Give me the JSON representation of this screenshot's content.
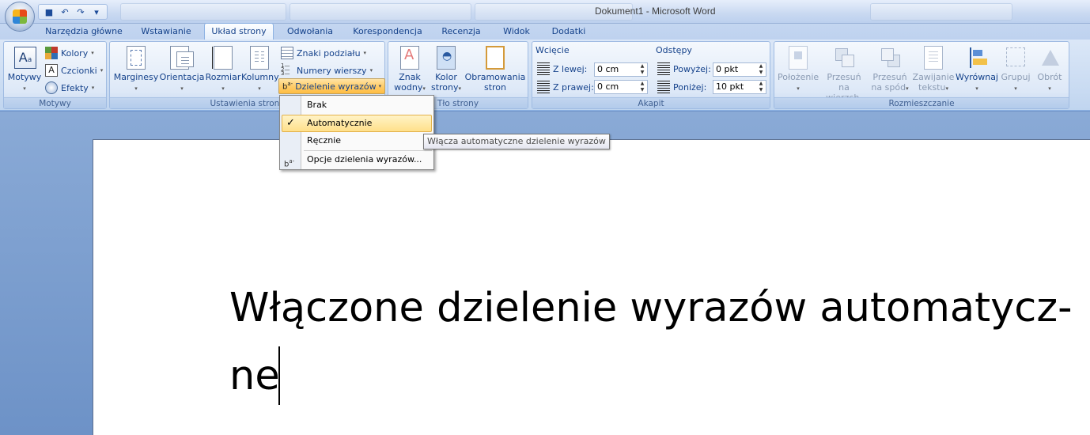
{
  "window": {
    "title": "Dokument1 - Microsoft Word"
  },
  "tabs": [
    "Narzędzia główne",
    "Wstawianie",
    "Układ strony",
    "Odwołania",
    "Korespondencja",
    "Recenzja",
    "Widok",
    "Dodatki"
  ],
  "active_tab": "Układ strony",
  "ribbon": {
    "motywy": {
      "label": "Motywy",
      "motywy_btn": "Motywy",
      "kolory": "Kolory",
      "czcionki": "Czcionki",
      "efekty": "Efekty"
    },
    "ustawienia": {
      "label": "Ustawienia strony",
      "marginesy": "Marginesy",
      "orientacja": "Orientacja",
      "rozmiar": "Rozmiar",
      "kolumny": "Kolumny",
      "znaki": "Znaki podziału",
      "numery": "Numery wierszy",
      "dzielenie": "Dzielenie wyrazów"
    },
    "tlo": {
      "label": "Tło strony",
      "znak1": "Znak",
      "znak2": "wodny",
      "kolor1": "Kolor",
      "kolor2": "strony",
      "obram1": "Obramowania",
      "obram2": "stron"
    },
    "akapit": {
      "label": "Akapit",
      "wciecie": "Wcięcie",
      "odstepy": "Odstępy",
      "z_lewej": "Z lewej:",
      "z_lewej_val": "0 cm",
      "z_prawej": "Z prawej:",
      "z_prawej_val": "0 cm",
      "powyzej": "Powyżej:",
      "powyzej_val": "0 pkt",
      "ponizej": "Poniżej:",
      "ponizej_val": "10 pkt"
    },
    "rozmieszczanie": {
      "label": "Rozmieszczanie",
      "polozenie": "Położenie",
      "przesun_na1": "Przesuń na",
      "przesun_na2": "wierzch",
      "przesun_spod1": "Przesuń",
      "przesun_spod2": "na spód",
      "zawijanie1": "Zawijanie",
      "zawijanie2": "tekstu",
      "wyrownaj": "Wyrównaj",
      "grupuj": "Grupuj",
      "obrot": "Obrót"
    }
  },
  "menu": {
    "items": [
      "Brak",
      "Automatycznie",
      "Ręcznie",
      "Opcje dzielenia wyrazów..."
    ],
    "checked": "Automatycznie"
  },
  "tooltip": "Włącza automatyczne dzielenie wyrazów",
  "document": {
    "line1": "Włączone dzielenie wyrazów automatycz-",
    "line2": "ne"
  },
  "colors": {
    "ribbon_text": "#15428b",
    "highlight": "#ffcd6a",
    "doc_bg": "#6d92c7"
  }
}
